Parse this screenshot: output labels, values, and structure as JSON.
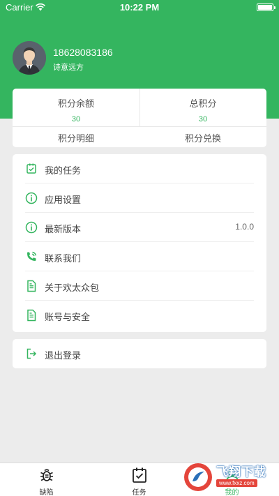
{
  "status_bar": {
    "carrier": "Carrier",
    "time": "10:22 PM"
  },
  "profile": {
    "phone": "18628083186",
    "nickname": "诗意远方"
  },
  "points": {
    "balance_label": "积分余额",
    "balance_value": "30",
    "total_label": "总积分",
    "total_value": "30",
    "detail_link": "积分明细",
    "exchange_link": "积分兑换"
  },
  "menu": {
    "items": [
      {
        "label": "我的任务",
        "icon": "task-check-icon"
      },
      {
        "label": "应用设置",
        "icon": "info-circle-icon"
      },
      {
        "label": "最新版本",
        "icon": "info-circle-icon",
        "value": "1.0.0"
      },
      {
        "label": "联系我们",
        "icon": "phone-icon"
      },
      {
        "label": "关于欢太众包",
        "icon": "document-icon"
      },
      {
        "label": "账号与安全",
        "icon": "document-icon"
      }
    ],
    "logout": {
      "label": "退出登录",
      "icon": "logout-icon"
    }
  },
  "tabbar": {
    "tabs": [
      {
        "label": "缺陷",
        "icon": "bug-icon"
      },
      {
        "label": "任务",
        "icon": "clipboard-check-icon"
      },
      {
        "label": "我的",
        "icon": "user-icon",
        "active": true
      }
    ]
  },
  "watermark": {
    "title": "飞翔下载",
    "url": "www.fxxz.com"
  },
  "colors": {
    "brand_green": "#34b55f",
    "background": "#ececec"
  }
}
